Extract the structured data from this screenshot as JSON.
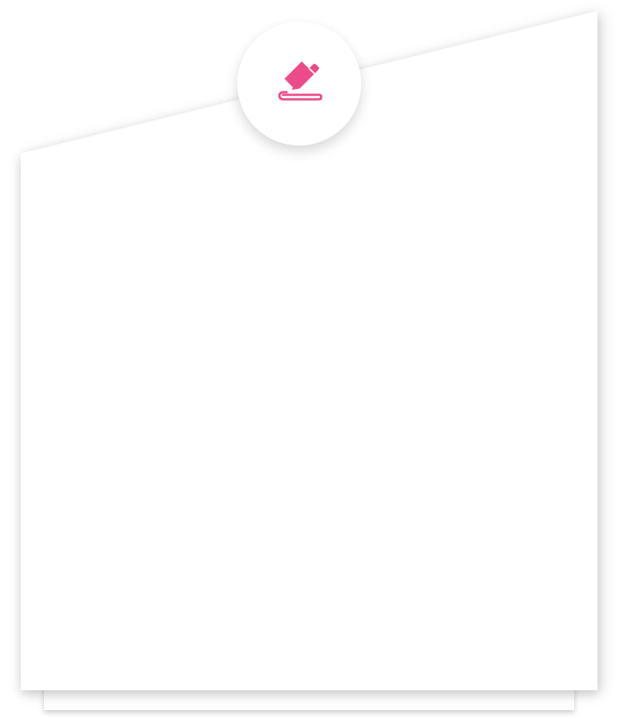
{
  "badge": {
    "icon": "edit-pencil-icon",
    "icon_color": "#ec4b8a"
  },
  "card": {
    "background": "#ffffff"
  }
}
